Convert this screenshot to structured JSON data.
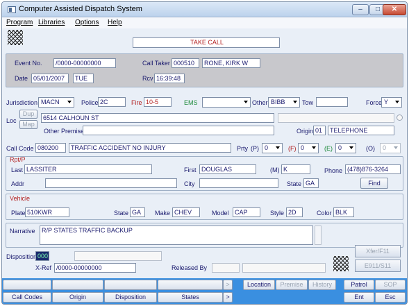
{
  "window": {
    "title": "Computer Assisted Dispatch System",
    "min": "–",
    "max": "□",
    "close": "✕"
  },
  "menu": [
    "Program",
    "Libraries",
    "Options",
    "Help"
  ],
  "banner": "TAKE CALL",
  "event": {
    "event_no_label": "Event No.",
    "event_no": "/0000-00000000",
    "call_taker_label": "Call Taker",
    "call_taker_id": "000510",
    "call_taker_name": "RONE, KIRK W",
    "date_label": "Date",
    "date": "05/01/2007",
    "day": "TUE",
    "rcv_label": "Rcv",
    "rcv": "16:39:48"
  },
  "jurisdiction": {
    "label": "Jurisdiction",
    "value": "MACN",
    "police_label": "Police",
    "police": "2C",
    "fire_label": "Fire",
    "fire": "10-5",
    "ems_label": "EMS",
    "ems": "",
    "other_label": "Other",
    "other": "BIBB",
    "tow_label": "Tow",
    "tow": "",
    "force_label": "Force",
    "force": "Y"
  },
  "location": {
    "loc_label": "Loc",
    "dup_label": "Dup",
    "map_label": "Map",
    "address": "6514 CALHOUN ST",
    "other_premise_label": "Other Premise",
    "other_premise": "",
    "origin_label": "Origin",
    "origin_code": "01",
    "origin_name": "TELEPHONE"
  },
  "callcode": {
    "label": "Call Code",
    "code": "080200",
    "desc": "TRAFFIC ACCIDENT NO INJURY",
    "prty_label": "Prty",
    "p_label": "(P)",
    "p": "0",
    "f_label": "(F)",
    "f": "0",
    "e_label": "(E)",
    "e": "0",
    "o_label": "(O)",
    "o": "0"
  },
  "rptp": {
    "section_label": "Rpt/P",
    "last_label": "Last",
    "last": "LASSITER",
    "first_label": "First",
    "first": "DOUGLAS",
    "mi_label": "(M)",
    "mi": "K",
    "phone_label": "Phone",
    "phone": "(478)876-3264",
    "addr_label": "Addr",
    "addr": "",
    "city_label": "City",
    "city": "",
    "state_label": "State",
    "state": "GA",
    "find_label": "Find"
  },
  "vehicle": {
    "section_label": "Vehicle",
    "plate_label": "Plate",
    "plate": "510KWR",
    "state_label": "State",
    "state": "GA",
    "make_label": "Make",
    "make": "CHEV",
    "model_label": "Model",
    "model": "CAP",
    "style_label": "Style",
    "style": "2D",
    "color_label": "Color",
    "color": "BLK"
  },
  "narrative": {
    "label": "Narrative",
    "text": "R/P STATES TRAFFIC BACKUP"
  },
  "disposition": {
    "label": "Disposition",
    "code": "000",
    "xref_label": "X-Ref",
    "xref": "/0000-00000000",
    "released_label": "Released By"
  },
  "side_buttons": {
    "xfer": "Xfer/F11",
    "e911": "E911/S11"
  },
  "toolbar": {
    "more": ">",
    "location": "Location",
    "premise": "Premise",
    "history": "History",
    "patrol": "Patrol",
    "sop": "SOP",
    "call_codes": "Call Codes",
    "origin": "Origin",
    "disposition": "Disposition",
    "states": "States",
    "ent": "Ent",
    "esc": "Esc"
  },
  "colors": {
    "accent_blue": "#3a8fe0",
    "label_navy": "#1a1a6e",
    "fire_red": "#b32020",
    "ems_green": "#1d8a3a"
  }
}
